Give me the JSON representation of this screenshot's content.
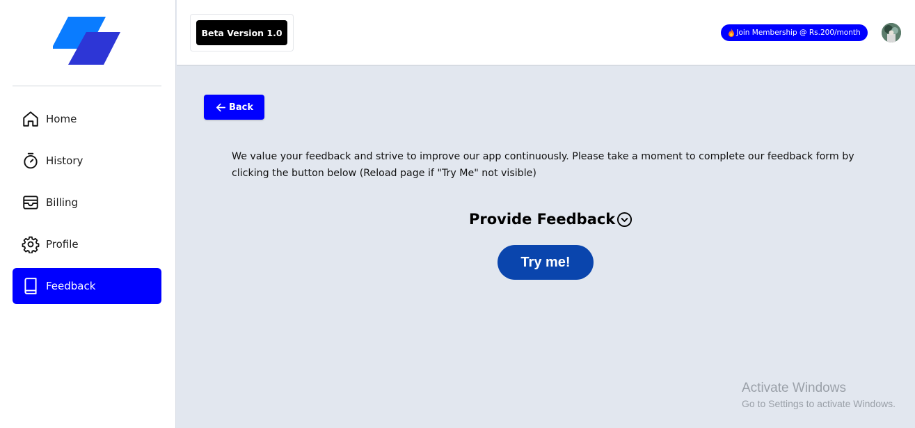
{
  "app": {
    "colors": {
      "accent": "#0000ff",
      "try_button": "#0a45ad",
      "background": "#e2e7ef"
    }
  },
  "sidebar": {
    "items": [
      {
        "label": "Home",
        "icon": "home-icon",
        "active": false
      },
      {
        "label": "History",
        "icon": "stopwatch-icon",
        "active": false
      },
      {
        "label": "Billing",
        "icon": "wallet-icon",
        "active": false
      },
      {
        "label": "Profile",
        "icon": "gear-icon",
        "active": false
      },
      {
        "label": "Feedback",
        "icon": "book-icon",
        "active": true
      }
    ]
  },
  "header": {
    "beta_label": "Beta Version 1.0",
    "membership_label": "Join Membership @ Rs.200/month"
  },
  "main": {
    "back_label": "Back",
    "message": "We value your feedback and strive to improve our app continuously. Please take a moment to complete our feedback form by clicking the button below (Reload page if \"Try Me\" not visible)",
    "feedback_title": "Provide Feedback",
    "try_label": "Try me!"
  },
  "watermark": {
    "line1": "Activate Windows",
    "line2": "Go to Settings to activate Windows."
  }
}
